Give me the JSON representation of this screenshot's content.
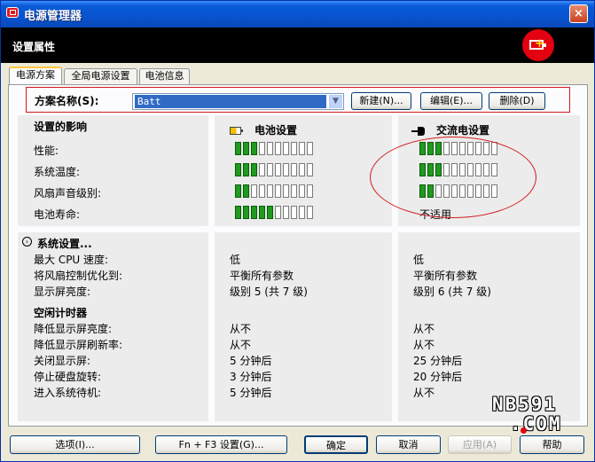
{
  "window": {
    "title": "电源管理器",
    "close": "×"
  },
  "header": {
    "title": "设置属性"
  },
  "tabs": [
    "电源方案",
    "全局电源设置",
    "电池信息"
  ],
  "scheme": {
    "label": "方案名称(S):",
    "value": "Batt",
    "new": "新建(N)...",
    "edit": "编辑(E)...",
    "delete": "删除(D)"
  },
  "impact": {
    "title": "设置的影响",
    "battery_title": "电池设置",
    "ac_title": "交流电设置",
    "rows": [
      {
        "label": "性能:",
        "battery_level": 3,
        "ac_level": 3
      },
      {
        "label": "系统温度:",
        "battery_level": 3,
        "ac_level": 3
      },
      {
        "label": "风扇声音级别:",
        "battery_level": 2,
        "ac_level": 2
      },
      {
        "label": "电池寿命:",
        "battery_level": 5,
        "ac_text": "不适用"
      }
    ],
    "max_level": 10
  },
  "system": {
    "title": "系统设置...",
    "rows": [
      {
        "label": "最大 CPU 速度:",
        "battery": "低",
        "ac": "低"
      },
      {
        "label": "将风扇控制优化到:",
        "battery": "平衡所有参数",
        "ac": "平衡所有参数"
      },
      {
        "label": "显示屏亮度:",
        "battery": "级别 5 (共 7 级)",
        "ac": "级别 6 (共 7 级)"
      }
    ]
  },
  "idle": {
    "title": "空闲计时器",
    "rows": [
      {
        "label": "降低显示屏亮度:",
        "battery": "从不",
        "ac": "从不"
      },
      {
        "label": "降低显示屏刷新率:",
        "battery": "从不",
        "ac": "从不"
      },
      {
        "label": "关闭显示屏:",
        "battery": "5 分钟后",
        "ac": "25 分钟后"
      },
      {
        "label": "停止硬盘旋转:",
        "battery": "3 分钟后",
        "ac": "20 分钟后"
      },
      {
        "label": "进入系统待机:",
        "battery": "5 分钟后",
        "ac": "从不"
      }
    ]
  },
  "footer": {
    "options": "选项(I)...",
    "fn_f3": "Fn + F3 设置(G)...",
    "ok": "确定",
    "cancel": "取消",
    "apply": "应用(A)",
    "help": "帮助"
  },
  "watermark": {
    "line1": "NB591",
    "line2": ".COM"
  }
}
